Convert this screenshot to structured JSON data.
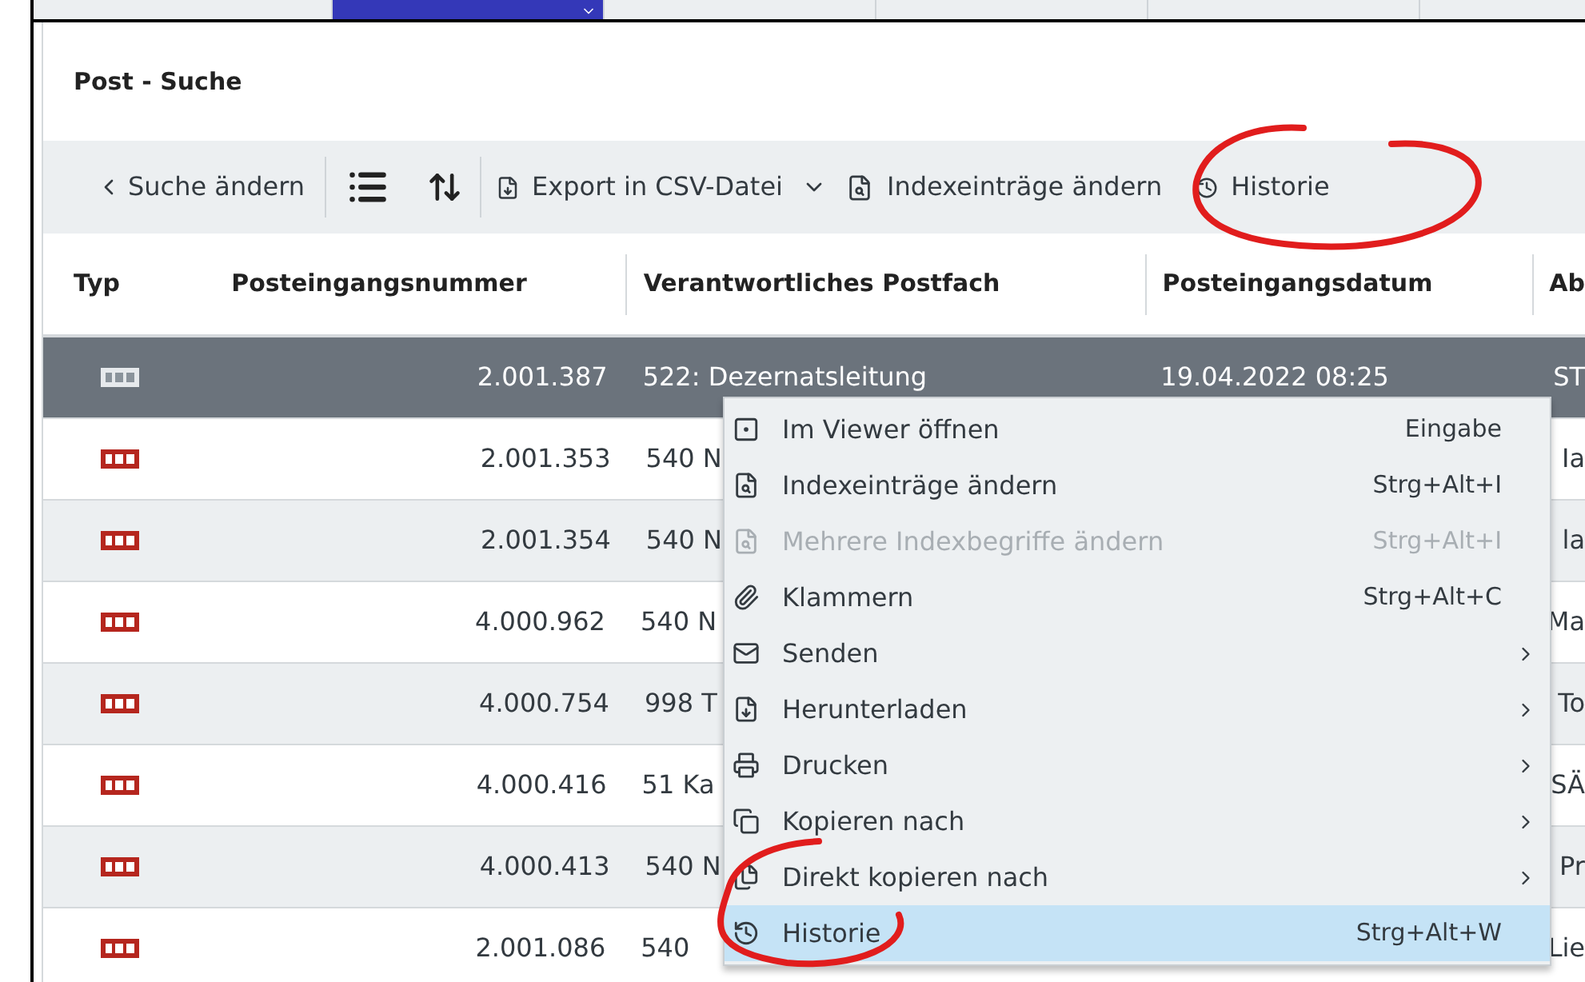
{
  "top_tabs": [
    {
      "selected": false
    },
    {
      "selected": true
    },
    {
      "selected": false
    },
    {
      "selected": false
    },
    {
      "selected": false
    }
  ],
  "title": "Post - Suche",
  "toolbar": {
    "back": "Suche ändern",
    "export": "Export in CSV-Datei",
    "index": "Indexeinträge ändern",
    "history": "Historie"
  },
  "table": {
    "columns": [
      "Typ",
      "Posteingangsnummer",
      "Verantwortliches Postfach",
      "Posteingangsdatum",
      "Ab"
    ],
    "rows": [
      {
        "selected": true,
        "number": "2.001.387",
        "postfach": "522: Dezernatsleitung",
        "datum": "19.04.2022 08:25",
        "column_5": "ST"
      },
      {
        "selected": false,
        "number": "2.001.353",
        "postfach": "540 N",
        "column_5": "Ia"
      },
      {
        "selected": false,
        "number": "2.001.354",
        "postfach": "540 N",
        "column_5": "la"
      },
      {
        "selected": false,
        "number": "4.000.962",
        "postfach": "540 N",
        "column_5": "Ma"
      },
      {
        "selected": false,
        "number": "4.000.754",
        "postfach": "998 T",
        "column_5": "To"
      },
      {
        "selected": false,
        "number": "4.000.416",
        "postfach": "51 Ka",
        "column_5": "SÄ"
      },
      {
        "selected": false,
        "number": "4.000.413",
        "postfach": "540 N",
        "column_5": "Pr"
      },
      {
        "selected": false,
        "number": "2.001.086",
        "postfach": "540",
        "column_5": "Lie"
      }
    ]
  },
  "context_menu": [
    {
      "label": "Im Viewer öffnen",
      "shortcut": "Eingabe",
      "submenu": false,
      "disabled": false,
      "selected": false
    },
    {
      "label": "Indexeinträge ändern",
      "shortcut": "Strg+Alt+I",
      "submenu": false,
      "disabled": false,
      "selected": false
    },
    {
      "label": "Mehrere Indexbegriffe ändern",
      "shortcut": "Strg+Alt+I",
      "submenu": false,
      "disabled": true,
      "selected": false
    },
    {
      "label": "Klammern",
      "shortcut": "Strg+Alt+C",
      "submenu": false,
      "disabled": false,
      "selected": false
    },
    {
      "label": "Senden",
      "submenu": true,
      "disabled": false,
      "selected": false
    },
    {
      "label": "Herunterladen",
      "submenu": true,
      "disabled": false,
      "selected": false
    },
    {
      "label": "Drucken",
      "submenu": true,
      "disabled": false,
      "selected": false
    },
    {
      "label": "Kopieren nach",
      "submenu": true,
      "disabled": false,
      "selected": false
    },
    {
      "label": "Direkt kopieren nach",
      "submenu": true,
      "disabled": false,
      "selected": false
    },
    {
      "label": "Historie",
      "shortcut": "Strg+Alt+W",
      "submenu": false,
      "disabled": false,
      "selected": true
    }
  ]
}
